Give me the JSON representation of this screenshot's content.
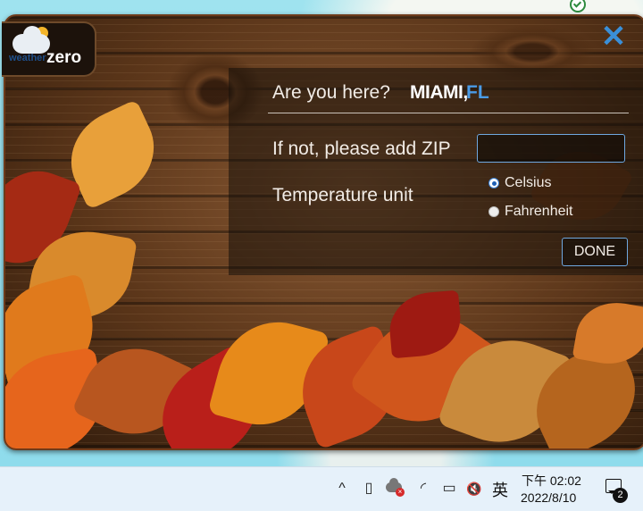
{
  "widget": {
    "logo": {
      "text_weather": "weather",
      "text_zero": "zero",
      "icon": "weather-zero-logo"
    },
    "close": {
      "glyph": "✕",
      "icon": "close-icon"
    },
    "location": {
      "question": "Are you here?",
      "city": "MIAMI,",
      "state": "FL"
    },
    "zip": {
      "label": "If not, please add ZIP",
      "value": "",
      "placeholder": ""
    },
    "temperature": {
      "label": "Temperature unit",
      "options": [
        {
          "label": "Celsius",
          "selected": true
        },
        {
          "label": "Fahrenheit",
          "selected": false
        }
      ]
    },
    "done_label": "DONE"
  },
  "taskbar": {
    "icons": [
      {
        "name": "show-hidden-icons",
        "glyph": "^"
      },
      {
        "name": "meet-now-icon",
        "glyph": "▯"
      },
      {
        "name": "onedrive-error-icon",
        "glyph": ""
      },
      {
        "name": "wifi-icon",
        "glyph": "◜"
      },
      {
        "name": "battery-icon",
        "glyph": "▭"
      },
      {
        "name": "volume-muted-icon",
        "glyph": "🔇"
      }
    ],
    "ime": "英",
    "time": "下午 02:02",
    "date": "2022/8/10",
    "notification_count": "2"
  },
  "colors": {
    "accent": "#4a9be6",
    "wood_dark": "#2e1a0b",
    "wood_mid": "#8a5a34",
    "taskbar_bg": "#e6f1fa"
  }
}
